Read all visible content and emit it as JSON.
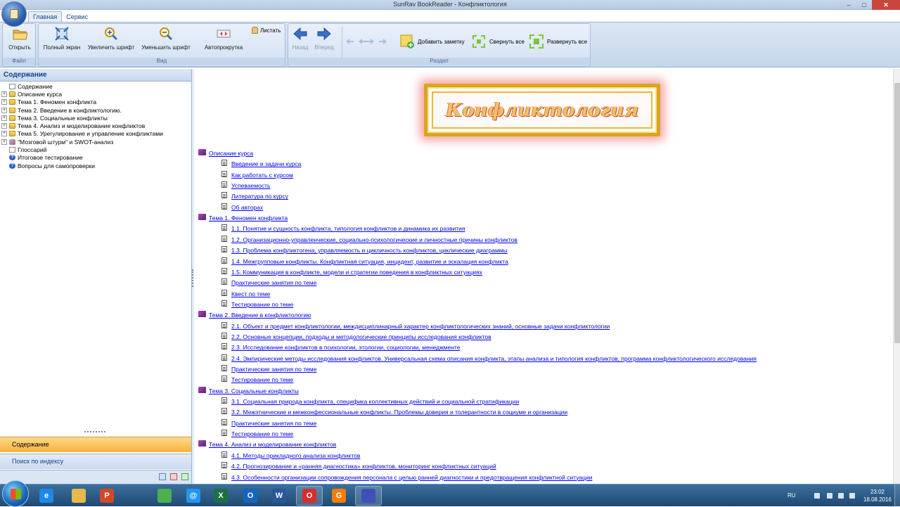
{
  "window": {
    "title": "SunRav BookReader - Конфликтология"
  },
  "tabs": [
    {
      "label": "Главная"
    },
    {
      "label": "Сервис"
    }
  ],
  "ribbon": {
    "file_group": {
      "label": "Файл",
      "open": "Открыть"
    },
    "view_group": {
      "label": "Вид",
      "fullscreen": "Полный экран",
      "zoom_in": "Увеличить шрифт",
      "zoom_out": "Уменьшить шрифт",
      "autoscroll": "Автопрокрутка",
      "flip": "Листать"
    },
    "section_group": {
      "label": "Раздел",
      "back": "Назад",
      "forward": "Вперед",
      "add_note": "Добавить заметку",
      "collapse_all": "Свернуть все",
      "expand_all": "Развернуть все"
    }
  },
  "left_panel": {
    "header": "Содержание",
    "tree": [
      {
        "label": "Содержание",
        "icon": "doc-icon",
        "expandable": false
      },
      {
        "label": "Описание курса",
        "icon": "folder-icon",
        "expandable": true
      },
      {
        "label": "Тема 1. Феномен конфликта",
        "icon": "folder-icon",
        "expandable": true
      },
      {
        "label": "Тема 2. Введение в конфликтологию.",
        "icon": "folder-icon",
        "expandable": true
      },
      {
        "label": "Тема 3. Социальные конфликты",
        "icon": "folder-icon",
        "expandable": true
      },
      {
        "label": "Тема 4. Анализ и моделирование конфликтов",
        "icon": "folder-icon",
        "expandable": true
      },
      {
        "label": "Тема 5. Урегулирование и управление конфликтами",
        "icon": "folder-icon",
        "expandable": true
      },
      {
        "label": "\"Мозговой штурм\" и SWOT-анализ",
        "icon": "network-icon",
        "expandable": true
      },
      {
        "label": "Глоссарий",
        "icon": "doc-icon",
        "expandable": false
      },
      {
        "label": "Итоговое тестирование",
        "icon": "help-icon",
        "expandable": false
      },
      {
        "label": "Вопросы для самопроверки",
        "icon": "help-icon",
        "expandable": false
      }
    ],
    "nav_contents": "Содержание",
    "nav_search": "Поиск по индексу"
  },
  "content": {
    "banner_title": "Конфликтология",
    "toc": [
      {
        "level": 0,
        "text": "Описание курса"
      },
      {
        "level": 1,
        "text": "Введение и задачи курса"
      },
      {
        "level": 1,
        "text": "Как работать с курсом"
      },
      {
        "level": 1,
        "text": "Успеваемость"
      },
      {
        "level": 1,
        "text": "Литература по курсу"
      },
      {
        "level": 1,
        "text": "Об авторах"
      },
      {
        "level": 0,
        "text": "Тема 1. Феномен конфликта"
      },
      {
        "level": 1,
        "text": "1.1. Понятие и сущность конфликта, типология конфликтов и динамика их развития"
      },
      {
        "level": 1,
        "text": "1.2. Организационно-управленческие, социально-психологические и личностные причины конфликтов"
      },
      {
        "level": 1,
        "text": "1.3. Проблема конфликтогена, управляемость и цикличность конфликтов, циклические диаграммы"
      },
      {
        "level": 1,
        "text": "1.4. Межгрупповые конфликты. Конфликтная ситуация, инцидент, развитие и эскалация конфликта"
      },
      {
        "level": 1,
        "text": "1.5. Коммуникация в конфликте, модели и стратегии поведения в конфликтных ситуациях"
      },
      {
        "level": 1,
        "text": "Практические занятия по теме"
      },
      {
        "level": 1,
        "text": "Квест по теме"
      },
      {
        "level": 1,
        "text": "Тестирование по теме"
      },
      {
        "level": 0,
        "text": "Тема 2. Введение в конфликтологию"
      },
      {
        "level": 1,
        "text": "2.1. Объект и предмет конфликтологии, междисциплинарный характер конфликтологических знаний, основные задачи конфликтологии"
      },
      {
        "level": 1,
        "text": "2.2. Основные концепции, подходы и методологические принципы исследования конфликтов"
      },
      {
        "level": 1,
        "text": "2.3. Исследование конфликтов в психологии, этологии, социологии, менеджменте"
      },
      {
        "level": 1,
        "text": "2.4. Эмпирические методы исследования конфликтов. Универсальная схема описания конфликта, этапы анализа и типология конфликтов, программа конфликтологического исследования"
      },
      {
        "level": 1,
        "text": "Практические занятия по теме"
      },
      {
        "level": 1,
        "text": "Тестирование по теме"
      },
      {
        "level": 0,
        "text": "Тема 3. Социальные конфликты"
      },
      {
        "level": 1,
        "text": "3.1. Социальная природа конфликта, специфика коллективных действий и социальной стратификации"
      },
      {
        "level": 1,
        "text": "3.2. Межэтнические и межконфессиональные конфликты. Проблемы доверия и толерантности в социуме и организации"
      },
      {
        "level": 1,
        "text": "Практические занятия по теме"
      },
      {
        "level": 1,
        "text": "Тестирование по теме"
      },
      {
        "level": 0,
        "text": "Тема 4. Анализ и моделирование конфликтов"
      },
      {
        "level": 1,
        "text": "4.1. Методы прикладного анализа конфликтов"
      },
      {
        "level": 1,
        "text": "4.2. Прогнозирование и «ранняя диагностика» конфликтов, мониторинг конфликтных ситуаций"
      },
      {
        "level": 1,
        "text": "4.3. Особенности организации сопровождения персонала с целью ранней диагностики и предотвращения конфликтной ситуации"
      }
    ]
  },
  "taskbar": {
    "apps": [
      {
        "name": "ie-icon",
        "color": "#1e88e5",
        "glyph": "e"
      },
      {
        "name": "explorer-icon",
        "color": "#e8b84a",
        "glyph": ""
      },
      {
        "name": "powerpoint-icon",
        "color": "#d24726",
        "glyph": "P"
      },
      {
        "name": "chrome-icon",
        "color": "#4caf50",
        "glyph": ""
      },
      {
        "name": "browser-icon",
        "color": "#2196f3",
        "glyph": "@"
      },
      {
        "name": "excel-icon",
        "color": "#1d7044",
        "glyph": "X"
      },
      {
        "name": "outlook-icon",
        "color": "#1565c0",
        "glyph": "O"
      },
      {
        "name": "word-icon",
        "color": "#2b579a",
        "glyph": "W"
      },
      {
        "name": "opera-icon",
        "color": "#d32f2f",
        "glyph": "O"
      },
      {
        "name": "pdf-icon",
        "color": "#f57c00",
        "glyph": "G"
      },
      {
        "name": "bookreader-icon",
        "color": "#3f51b5",
        "glyph": ""
      }
    ],
    "lang": "RU",
    "time": "23:02",
    "date": "18.08.2016"
  }
}
